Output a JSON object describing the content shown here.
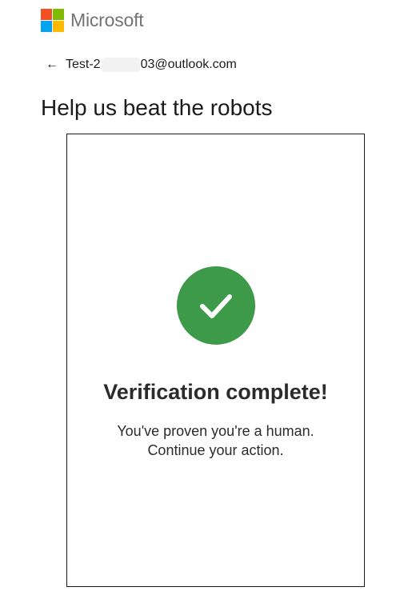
{
  "brand": {
    "name": "Microsoft",
    "logo_colors": [
      "#f25022",
      "#7fba00",
      "#00a4ef",
      "#ffb900"
    ]
  },
  "identity": {
    "back_icon": "left-arrow-icon",
    "email_prefix": "Test-2",
    "email_suffix": "03@outlook.com"
  },
  "page": {
    "title": "Help us beat the robots"
  },
  "challenge": {
    "status_icon": "checkmark-icon",
    "status_color": "#3c9a48",
    "title": "Verification complete!",
    "message_line1": "You've proven you're a human.",
    "message_line2": "Continue your action."
  }
}
